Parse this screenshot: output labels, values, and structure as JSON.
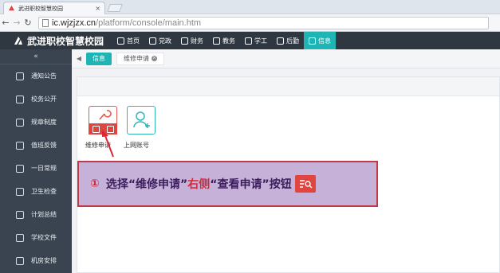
{
  "browser": {
    "tab_title": "武进职校智慧校园",
    "tab_close": "×",
    "url_host": "ic.wjzjzx.cn",
    "url_path": "/platform/console/main.htm"
  },
  "header": {
    "brand": "武进职校智慧校园",
    "nav": [
      {
        "label": "首页",
        "icon": "home-icon"
      },
      {
        "label": "党政",
        "icon": "building-icon"
      },
      {
        "label": "财务",
        "icon": "finance-icon"
      },
      {
        "label": "教务",
        "icon": "book-icon"
      },
      {
        "label": "学工",
        "icon": "user-icon"
      },
      {
        "label": "后勤",
        "icon": "flag-icon"
      },
      {
        "label": "信息",
        "icon": "info-icon",
        "active": true
      }
    ]
  },
  "sidebar": {
    "collapse": "«",
    "items": [
      {
        "label": "通知公告",
        "icon": "megaphone-icon"
      },
      {
        "label": "校务公开",
        "icon": "document-icon"
      },
      {
        "label": "规章制度",
        "icon": "list-icon"
      },
      {
        "label": "值班反馈",
        "icon": "edit-icon"
      },
      {
        "label": "一日常规",
        "icon": "clock-icon"
      },
      {
        "label": "卫生检查",
        "icon": "checklist-icon"
      },
      {
        "label": "计划总结",
        "icon": "calendar-icon"
      },
      {
        "label": "学校文件",
        "icon": "file-icon"
      },
      {
        "label": "机房安排",
        "icon": "grid-icon"
      }
    ]
  },
  "subtabs": {
    "back": "◀",
    "active": "信息",
    "open": "维修申请"
  },
  "apps": [
    {
      "label": "维修申请",
      "icon": "wrench-icon"
    },
    {
      "label": "上网账号",
      "icon": "user-add-icon"
    }
  ],
  "callout": {
    "number": "①",
    "part1": "选择“维修申请”",
    "part2": "右侧",
    "part3": "“查看申请”",
    "part4": "按钮"
  },
  "colors": {
    "accent": "#1fb5b5",
    "header_bg": "#2f3741",
    "sidebar_bg": "#3a4450",
    "red": "#e0453f",
    "callout_bg": "#c6b2d8"
  }
}
